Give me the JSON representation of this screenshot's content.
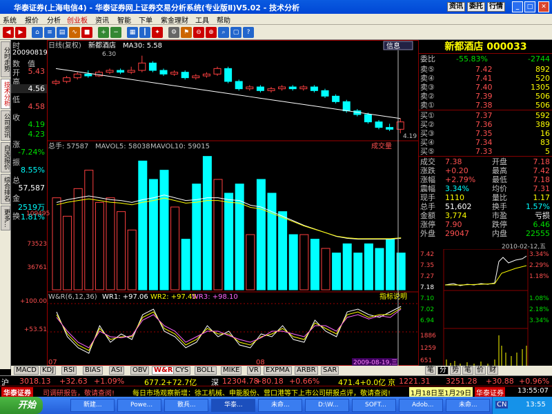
{
  "window": {
    "title": "华泰证券(上海电信4) - 华泰证券网上证券交易分析系统(专业版Ⅱ)V5.02 - 技术分析",
    "btn_info": "资讯",
    "btn_commission": "委托",
    "btn_quote": "行情"
  },
  "menu": [
    "系统",
    "报价",
    "分析",
    "创业板",
    "资讯",
    "智能",
    "下单",
    "紫金理财",
    "工具",
    "帮助"
  ],
  "leftside": [
    "分时走势",
    "技术分析",
    "公司资讯",
    "自选报价",
    "综合排名",
    "更多..."
  ],
  "info": {
    "labels": [
      "时",
      "数",
      "值",
      "开",
      "高",
      "低",
      "收",
      "涨",
      "幅",
      "振",
      "幅",
      "总",
      "手",
      "金",
      "额",
      "换",
      "手"
    ],
    "time": "20090819",
    "open": "5.43",
    "high": "4.56",
    "low": "4.58",
    "close": "4.19",
    "c2": "4.23",
    "chg": "-7.24%",
    "amp": "8.55%",
    "vol": "57,587",
    "amt": "2519万",
    "turn": "1.81%"
  },
  "chart": {
    "top_label": "日线(复权)",
    "stock": "新都酒店",
    "ma": "MA30: 5.58",
    "info_btn": "信息",
    "price_high": "6.30",
    "price_low": "4.19",
    "vol_label": "总手: 57587",
    "vol_ma5": "MAVOL5: 58038",
    "vol_ma10": "MAVOL10: 59015",
    "vol_ticks": [
      "109495",
      "73523",
      "36761"
    ],
    "vol_btn": "成交量",
    "wr_label": "W&R(6,12,36)",
    "wr1": "WR1: +97.06",
    "wr2": "WR2: +97.45",
    "wr3": "WR3: +98.10",
    "wr_ticks": [
      "+100.00",
      "+53.51"
    ],
    "wr_btn": "指标说明",
    "x_labels": [
      "07",
      "08"
    ],
    "cursor_date": "2009-08-19,三"
  },
  "chart_data": {
    "type": "bar",
    "volume": [
      100,
      80,
      110,
      130,
      95,
      100,
      85,
      65,
      140,
      120,
      130,
      90,
      55,
      115,
      145,
      120,
      105,
      115,
      60,
      120,
      105,
      85,
      60,
      60,
      55,
      45,
      40,
      50,
      40,
      50,
      45,
      55,
      40
    ],
    "volume_style": [
      "h",
      "h",
      "h",
      "h",
      "h",
      "h",
      "h",
      "h",
      "s",
      "s",
      "s",
      "h",
      "s",
      "s",
      "s",
      "h",
      "s",
      "s",
      "h",
      "s",
      "s",
      "s",
      "s",
      "h",
      "s",
      "h",
      "s",
      "s",
      "s",
      "s",
      "s",
      "s",
      "s"
    ],
    "candles": [
      [
        5.55,
        5.6,
        5.5,
        5.65
      ],
      [
        5.6,
        5.7,
        5.55,
        5.75
      ],
      [
        5.7,
        5.8,
        5.65,
        5.85
      ],
      [
        5.8,
        5.75,
        5.7,
        5.9
      ],
      [
        5.75,
        5.85,
        5.72,
        5.9
      ],
      [
        5.85,
        5.9,
        5.8,
        5.95
      ],
      [
        5.9,
        5.85,
        5.8,
        5.95
      ],
      [
        5.85,
        5.9,
        5.8,
        6.0
      ],
      [
        5.9,
        6.1,
        5.85,
        6.3
      ],
      [
        6.1,
        5.9,
        5.85,
        6.15
      ],
      [
        5.9,
        5.8,
        5.75,
        5.95
      ],
      [
        5.8,
        5.85,
        5.75,
        5.9
      ],
      [
        5.85,
        5.7,
        5.65,
        5.9
      ],
      [
        5.7,
        5.75,
        5.65,
        5.8
      ],
      [
        5.75,
        5.8,
        5.7,
        5.85
      ],
      [
        5.8,
        5.95,
        5.75,
        6.0
      ],
      [
        5.95,
        5.6,
        5.55,
        6.0
      ],
      [
        5.6,
        5.4,
        5.35,
        5.65
      ],
      [
        5.4,
        5.45,
        5.35,
        5.5
      ],
      [
        5.45,
        5.35,
        5.3,
        5.5
      ],
      [
        5.35,
        5.4,
        5.3,
        5.45
      ],
      [
        5.4,
        5.45,
        5.35,
        5.5
      ],
      [
        5.45,
        5.4,
        5.35,
        5.5
      ],
      [
        5.4,
        5.45,
        5.35,
        5.5
      ],
      [
        5.45,
        5.35,
        5.3,
        5.5
      ],
      [
        5.35,
        5.2,
        5.15,
        5.4
      ],
      [
        5.2,
        5.05,
        5.0,
        5.25
      ],
      [
        5.05,
        4.8,
        4.75,
        5.1
      ],
      [
        4.8,
        4.7,
        4.65,
        4.85
      ],
      [
        4.7,
        4.5,
        4.45,
        4.75
      ],
      [
        4.5,
        4.35,
        4.3,
        4.55
      ],
      [
        4.35,
        4.3,
        4.25,
        4.45
      ],
      [
        4.3,
        4.5,
        4.19,
        4.6
      ]
    ],
    "wr1": [
      15,
      60,
      80,
      90,
      40,
      70,
      55,
      65,
      20,
      10,
      50,
      60,
      80,
      70,
      40,
      60,
      50,
      75,
      80,
      55,
      60,
      40,
      65,
      70,
      30,
      50,
      60,
      15,
      10,
      20,
      25,
      15,
      5
    ],
    "wr2": [
      20,
      55,
      75,
      85,
      45,
      65,
      60,
      60,
      25,
      15,
      45,
      55,
      75,
      65,
      45,
      55,
      55,
      70,
      75,
      60,
      55,
      45,
      60,
      65,
      35,
      45,
      55,
      20,
      15,
      25,
      20,
      20,
      8
    ],
    "wr3": [
      25,
      50,
      70,
      80,
      50,
      60,
      62,
      58,
      30,
      20,
      40,
      50,
      70,
      60,
      50,
      50,
      58,
      65,
      70,
      62,
      50,
      50,
      55,
      60,
      40,
      40,
      50,
      25,
      20,
      28,
      22,
      25,
      10
    ],
    "ma_vol": [
      95,
      98,
      100,
      102,
      100,
      98,
      97,
      95,
      98,
      100,
      103,
      100,
      97,
      98,
      100,
      100,
      98,
      97,
      92,
      90,
      85,
      80,
      75,
      70,
      66,
      62,
      58,
      56,
      55,
      55,
      55,
      55,
      56
    ]
  },
  "quote": {
    "name": "新都酒店 000033",
    "wb": [
      "委比",
      "-55.83%",
      "-2744"
    ],
    "sells": [
      [
        "卖⑤",
        "7.42",
        "892"
      ],
      [
        "卖④",
        "7.41",
        "520"
      ],
      [
        "卖③",
        "7.40",
        "1305"
      ],
      [
        "卖②",
        "7.39",
        "506"
      ],
      [
        "卖①",
        "7.38",
        "506"
      ]
    ],
    "buys": [
      [
        "买①",
        "7.37",
        "592"
      ],
      [
        "买②",
        "7.36",
        "389"
      ],
      [
        "买③",
        "7.35",
        "16"
      ],
      [
        "买④",
        "7.34",
        "83"
      ],
      [
        "买⑤",
        "7.33",
        "5"
      ]
    ],
    "stats": [
      [
        "成交",
        "7.38",
        "开盘",
        "7.18"
      ],
      [
        "涨跌",
        "+0.20",
        "最高",
        "7.42"
      ],
      [
        "涨幅",
        "+2.79%",
        "最低",
        "7.18"
      ],
      [
        "震幅",
        "3.34%",
        "均价",
        "7.31"
      ],
      [
        "现手",
        "1110",
        "量比",
        "1.17"
      ],
      [
        "总手",
        "51,602",
        "换手",
        "1.57%"
      ],
      [
        "金额",
        "3,774",
        "市盈",
        "亏损"
      ],
      [
        "涨停",
        "7.90",
        "跌停",
        "6.46"
      ],
      [
        "外盘",
        "29047",
        "内盘",
        "22555"
      ]
    ],
    "mini_date": "2010-02-12,五",
    "mini_prices": [
      "7.42",
      "7.35",
      "7.27",
      "7.18"
    ],
    "mini_pcts": [
      "3.34%",
      "2.29%",
      "1.18%",
      "1.08%",
      "2.18%",
      "3.34%"
    ],
    "mini_low": [
      "7.10",
      "7.02",
      "6.94"
    ],
    "mini_vol": [
      "1886",
      "1259",
      "651"
    ]
  },
  "tabs": [
    "MACD",
    "KDJ",
    "RSI",
    "BIAS",
    "ASI",
    "OBV",
    "W&R",
    "CYS",
    "BOLL",
    "MIKE",
    "VR",
    "EXPMA",
    "ARBR",
    "SAR"
  ],
  "rtabs": [
    "笔",
    "分",
    "势",
    "笔",
    "价",
    "财"
  ],
  "status1": {
    "sh": "沪",
    "sh_idx": "3018.13",
    "sh_chg": "+32.63",
    "sh_pct": "+1.09%",
    "sh_vol": "677.2+72.7亿",
    "sz": "深",
    "sz_idx": "12304.78",
    "sz_chg": "+80.18",
    "sz_pct": "+0.66%",
    "sz_vol": "471.4+0.0亿",
    "cy": "1221.31",
    "cy_lbl": "京",
    "z": "3251.28",
    "z_chg": "+30.88",
    "z_pct": "+0.96%"
  },
  "status2": {
    "logo": "华泰证券",
    "msg1": "司调研报告，敬请查阅!",
    "msg2": "每日市场观察新增：徐工机械、申能股份、营口港等下上市公司研报点评，敬请查阅!",
    "date": "1月18日至1月29日",
    "icon": "华泰证券",
    "time": "13:55:07"
  },
  "taskbar": {
    "start": "开始",
    "tasks": [
      "新建...",
      "Powe...",
      "散兵...",
      "华泰...",
      "未命...",
      "D:\\W...",
      "SOFT...",
      "Adob...",
      "未命..."
    ],
    "cn": "CN",
    "clock": "13:55"
  }
}
